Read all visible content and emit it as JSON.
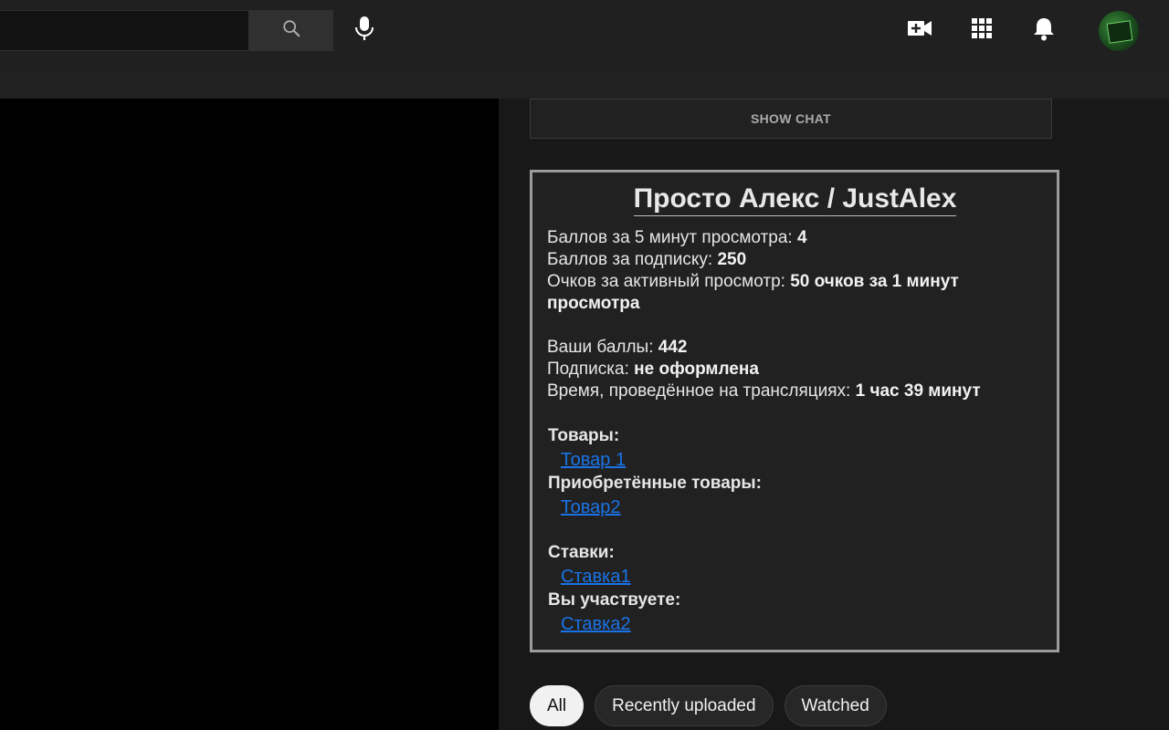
{
  "header": {
    "search": {
      "value": "",
      "placeholder": ""
    },
    "icons": [
      "search-icon",
      "microphone-icon",
      "create-video-icon",
      "apps-grid-icon",
      "notifications-bell-icon",
      "avatar"
    ]
  },
  "chat": {
    "show_chat_label": "SHOW CHAT"
  },
  "widget": {
    "title": "Просто Алекс / JustAlex",
    "rows1": [
      {
        "label": "Баллов за 5 минут просмотра: ",
        "value": "4"
      },
      {
        "label": "Баллов за подписку: ",
        "value": "250"
      },
      {
        "label": "Очков за активный просмотр: ",
        "value": "50 очков за 1 минут просмотра"
      }
    ],
    "rows2": [
      {
        "label": "Ваши баллы: ",
        "value": "442"
      },
      {
        "label": "Подписка: ",
        "value": "не оформлена"
      },
      {
        "label": "Время, проведённое на трансляциях: ",
        "value": "1 час 39 минут"
      }
    ],
    "goods_title": "Товары:",
    "goods_link": "Товар 1",
    "bought_title": "Приобретённые товары:",
    "bought_link": "Товар2",
    "bets_title": "Ставки:",
    "bets_link": "Ставка1",
    "participating_title": "Вы участвуете:",
    "participating_link": "Ставка2"
  },
  "chips": [
    {
      "label": "All",
      "active": true
    },
    {
      "label": "Recently uploaded",
      "active": false
    },
    {
      "label": "Watched",
      "active": false
    }
  ],
  "colors": {
    "link": "#1a73e8",
    "panel_border": "#9b9b9b",
    "background": "#181818"
  }
}
